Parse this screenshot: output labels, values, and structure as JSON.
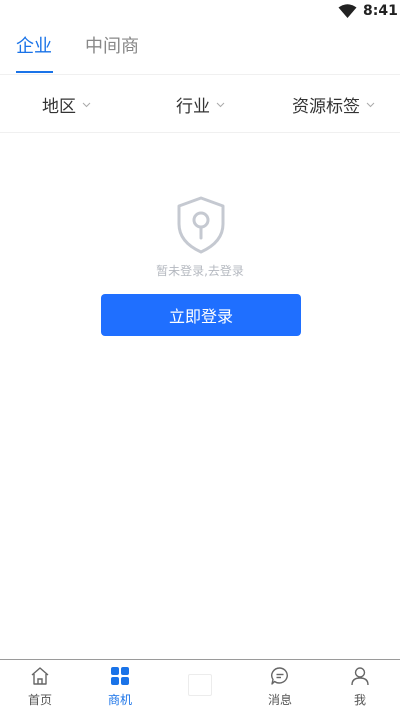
{
  "status": {
    "time": "8:41",
    "wifi_icon": "wifi-icon"
  },
  "tabs": [
    {
      "label": "企业",
      "active": true
    },
    {
      "label": "中间商",
      "active": false
    }
  ],
  "filters": [
    {
      "label": "地区"
    },
    {
      "label": "行业"
    },
    {
      "label": "资源标签"
    }
  ],
  "empty": {
    "icon": "shield-lock-icon",
    "text": "暂未登录,去登录",
    "button": "立即登录"
  },
  "nav": [
    {
      "label": "首页",
      "icon": "home-icon",
      "active": false
    },
    {
      "label": "商机",
      "icon": "grid-icon",
      "active": true
    },
    {
      "label": "",
      "icon": "blank-icon",
      "active": false
    },
    {
      "label": "消息",
      "icon": "message-icon",
      "active": false
    },
    {
      "label": "我",
      "icon": "user-icon",
      "active": false
    }
  ],
  "colors": {
    "accent": "#1a73e8",
    "button": "#1f6fff",
    "muted": "#b5b9c0"
  }
}
